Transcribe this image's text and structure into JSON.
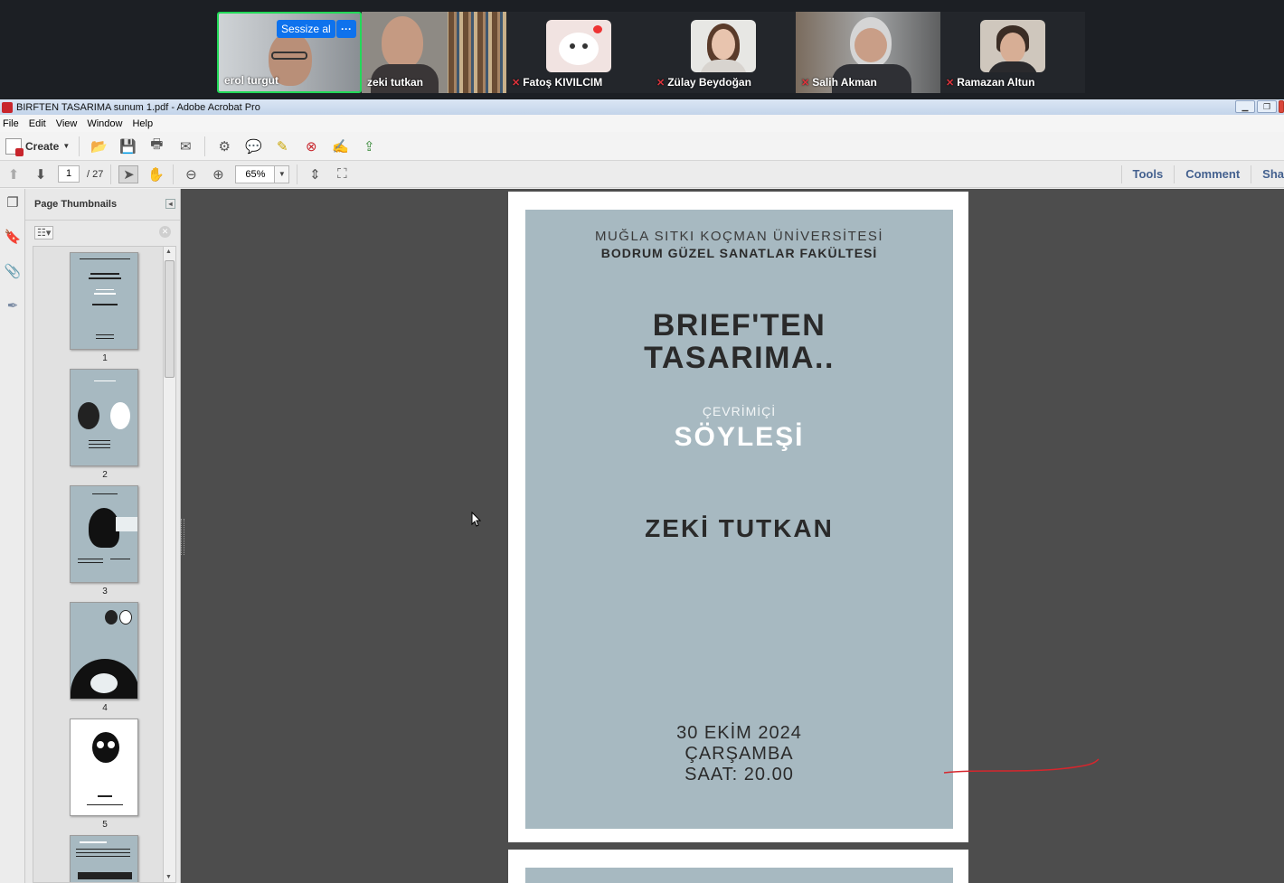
{
  "meeting": {
    "participants": [
      {
        "name": "erol turgut",
        "muted": false,
        "active": true
      },
      {
        "name": "zeki tutkan",
        "muted": false,
        "active": false
      },
      {
        "name": "Fatoş KIVILCIM",
        "muted": true,
        "active": false
      },
      {
        "name": "Zülay Beydoğan",
        "muted": true,
        "active": false
      },
      {
        "name": "Salih Akman",
        "muted": true,
        "active": false
      },
      {
        "name": "Ramazan Altun",
        "muted": true,
        "active": false
      }
    ],
    "mute_button_label": "Sessize al",
    "more_button_label": "···"
  },
  "window": {
    "title": "BIRFTEN TASARIMA sunum 1.pdf - Adobe Acrobat Pro"
  },
  "menu": [
    "File",
    "Edit",
    "View",
    "Window",
    "Help"
  ],
  "toolbar": {
    "create_label": "Create",
    "page_current": "1",
    "page_total": "/ 27",
    "zoom": "65%",
    "tabs": [
      "Tools",
      "Comment",
      "Sha"
    ]
  },
  "thumbnails": {
    "title": "Page Thumbnails",
    "pages": [
      "1",
      "2",
      "3",
      "4",
      "5"
    ]
  },
  "poster": {
    "university": "MUĞLA SITKI KOÇMAN ÜNİVERSİTESİ",
    "faculty": "BODRUM GÜZEL SANATLAR FAKÜLTESİ",
    "title_line1": "BRIEF'TEN",
    "title_line2": "TASARIMA..",
    "online": "ÇEVRİMİÇİ",
    "talk": "SÖYLEŞİ",
    "speaker": "ZEKİ TUTKAN",
    "date": "30 EKİM 2024",
    "day": "ÇARŞAMBA",
    "time": "SAAT: 20.00"
  },
  "colors": {
    "poster_bg": "#a7b9c1",
    "doc_bg": "#4d4d4d",
    "active_speaker": "#23d959",
    "zoom_blue": "#0e72ed",
    "annotation_red": "#d6262d"
  }
}
